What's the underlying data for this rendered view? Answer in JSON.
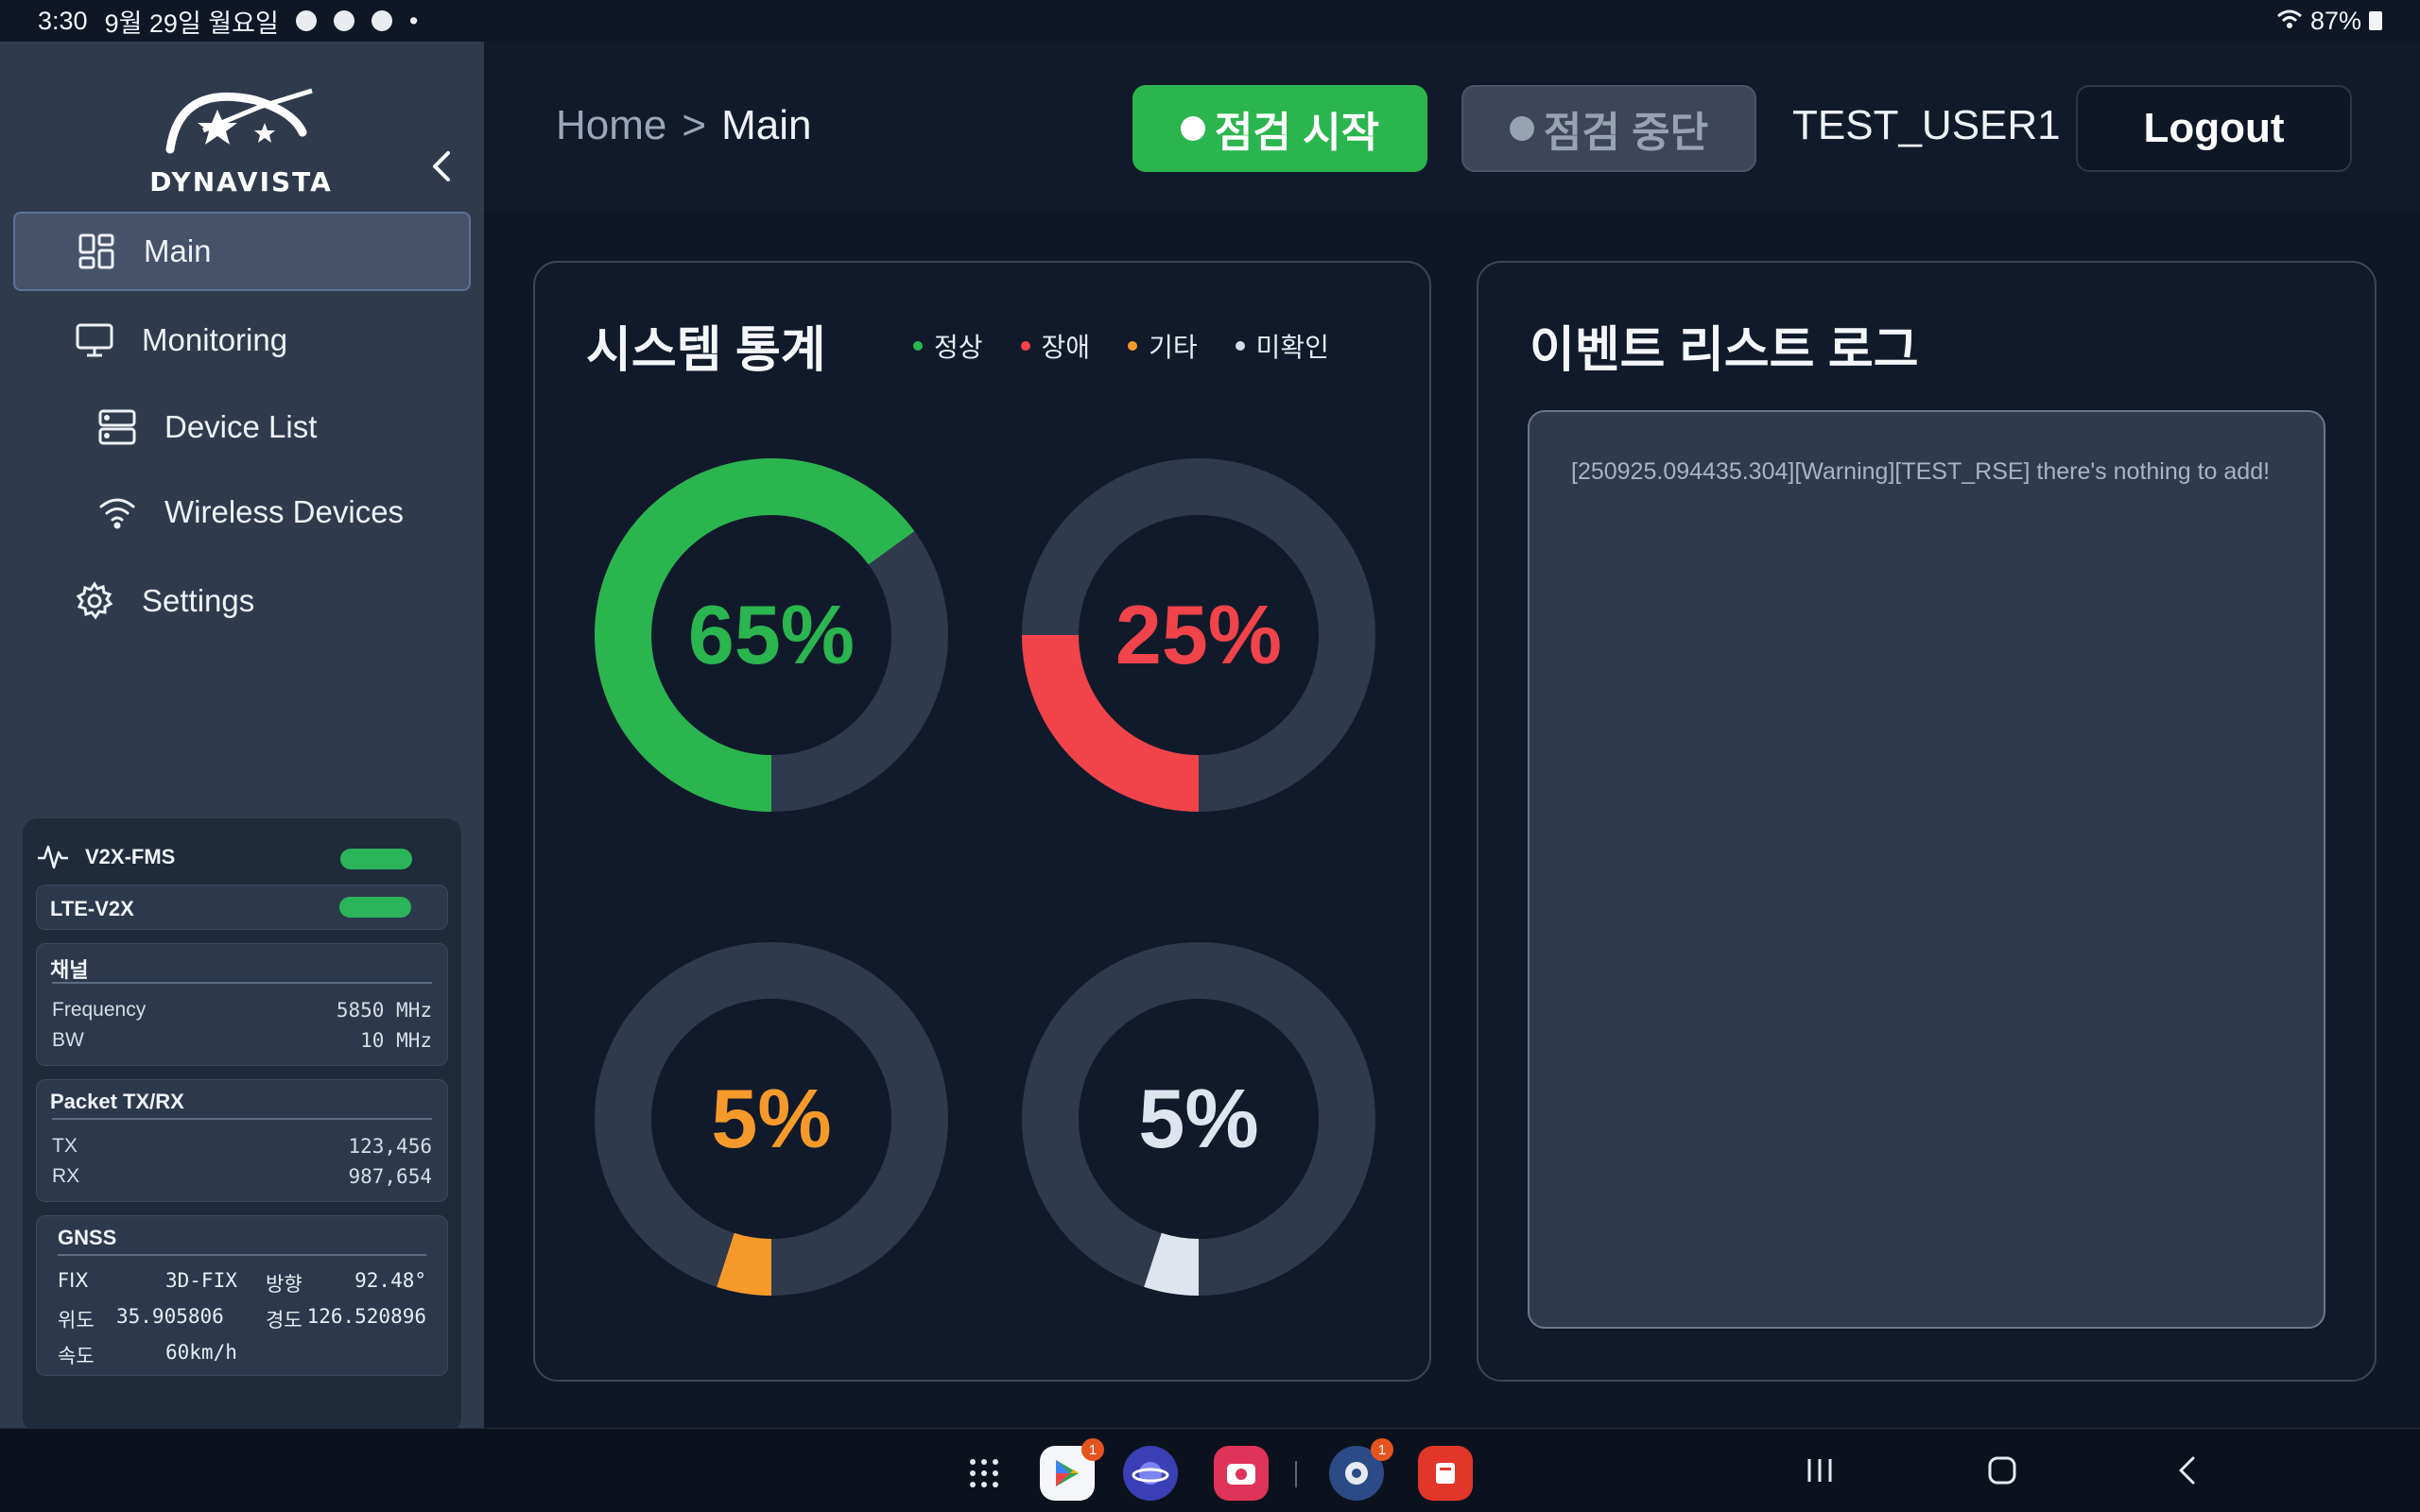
{
  "statusbar": {
    "time": "3:30",
    "date": "9월 29일 월요일",
    "battery": "87%"
  },
  "sidebar": {
    "logo_text": "DYNAVISTA",
    "items": [
      {
        "label": "Main",
        "icon": "grid-icon",
        "active": true
      },
      {
        "label": "Monitoring",
        "icon": "monitor-icon"
      },
      {
        "label": "Device List",
        "icon": "server-icon"
      },
      {
        "label": "Wireless Devices",
        "icon": "wifi-icon"
      },
      {
        "label": "Settings",
        "icon": "gear-icon"
      }
    ]
  },
  "status_panel": {
    "title": "V2X-FMS",
    "lte_label": "LTE-V2X",
    "channel": {
      "title": "채널",
      "frequency_label": "Frequency",
      "frequency_value": "5850 MHz",
      "bw_label": "BW",
      "bw_value": "10 MHz"
    },
    "packet": {
      "title": "Packet TX/RX",
      "tx_label": "TX",
      "tx_value": "123,456",
      "rx_label": "RX",
      "rx_value": "987,654"
    },
    "gnss": {
      "title": "GNSS",
      "fix_label": "FIX",
      "fix_value": "3D-FIX",
      "heading_label": "방향",
      "heading_value": "92.48°",
      "lat_label": "위도",
      "lat_value": "35.905806",
      "lon_label": "경도",
      "lon_value": "126.520896",
      "speed_label": "속도",
      "speed_value": "60km/h"
    }
  },
  "header": {
    "breadcrumb_home": "Home",
    "breadcrumb_sep": ">",
    "breadcrumb_current": "Main",
    "start_label": "점검 시작",
    "stop_label": "점검 중단",
    "username": "TEST_USER1",
    "logout_label": "Logout"
  },
  "stats": {
    "title": "시스템 통계",
    "legend": [
      {
        "label": "정상",
        "color": "#2bb54f"
      },
      {
        "label": "장애",
        "color": "#f0434a"
      },
      {
        "label": "기타",
        "color": "#f59a2a"
      },
      {
        "label": "미확인",
        "color": "#d6dde7"
      }
    ],
    "donuts": [
      {
        "label": "65%",
        "value": 65,
        "color": "#2bb54f"
      },
      {
        "label": "25%",
        "value": 25,
        "color": "#f0434a"
      },
      {
        "label": "5%",
        "value": 5,
        "color": "#f59a2a"
      },
      {
        "label": "5%",
        "value": 5,
        "color": "#dfe5ee"
      }
    ]
  },
  "events": {
    "title": "이벤트 리스트 로그",
    "log_text": "[250925.094435.304][Warning][TEST_RSE] there's nothing to add!"
  },
  "colors": {
    "accent_green": "#2bb54f",
    "track": "#2f3a4d"
  }
}
